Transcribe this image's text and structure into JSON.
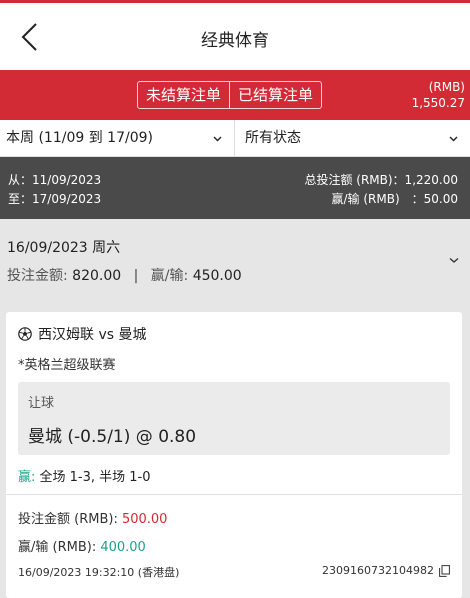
{
  "header": {
    "title": "经典体育"
  },
  "tabs": {
    "unsettled": "未结算注单",
    "settled": "已结算注单"
  },
  "balance": {
    "currency": "(RMB)",
    "amount": "1,550.27"
  },
  "filters": {
    "period": "本周 (11/09 到 17/09)",
    "status": "所有状态"
  },
  "summary": {
    "from": "从：11/09/2023",
    "to": "至：17/09/2023",
    "total_label": "总投注额 (RMB)：1,220.00",
    "winloss_label": "赢/输 (RMB)　：50.00"
  },
  "day": {
    "date": "16/09/2023 周六",
    "stake_label": "投注金额:",
    "stake_value": "820.00",
    "separator": "|",
    "winloss_label": "赢/输:",
    "winloss_value": "450.00"
  },
  "bet": {
    "match": "西汉姆联 vs 曼城",
    "league": "*英格兰超级联赛",
    "type": "让球",
    "selection": "曼城 (-0.5/1) @ 0.80",
    "result_status": "赢:",
    "result_text": " 全场 1-3, 半场 1-0",
    "stake_label": "投注金额 (RMB): ",
    "stake_value": "500.00",
    "winloss_label": "赢/输 (RMB): ",
    "winloss_value": "400.00",
    "timestamp": "16/09/2023 19:32:10 (香港盘)",
    "ticket_id": "2309160732104982"
  },
  "colors": {
    "accent": "#d32b36",
    "win": "#1fa28a",
    "dark": "#4a4a4a"
  },
  "icons": {
    "back": "chevron-left-icon",
    "dropdown": "chevron-down-icon",
    "sport": "soccer-ball-icon",
    "copy": "copy-icon"
  }
}
